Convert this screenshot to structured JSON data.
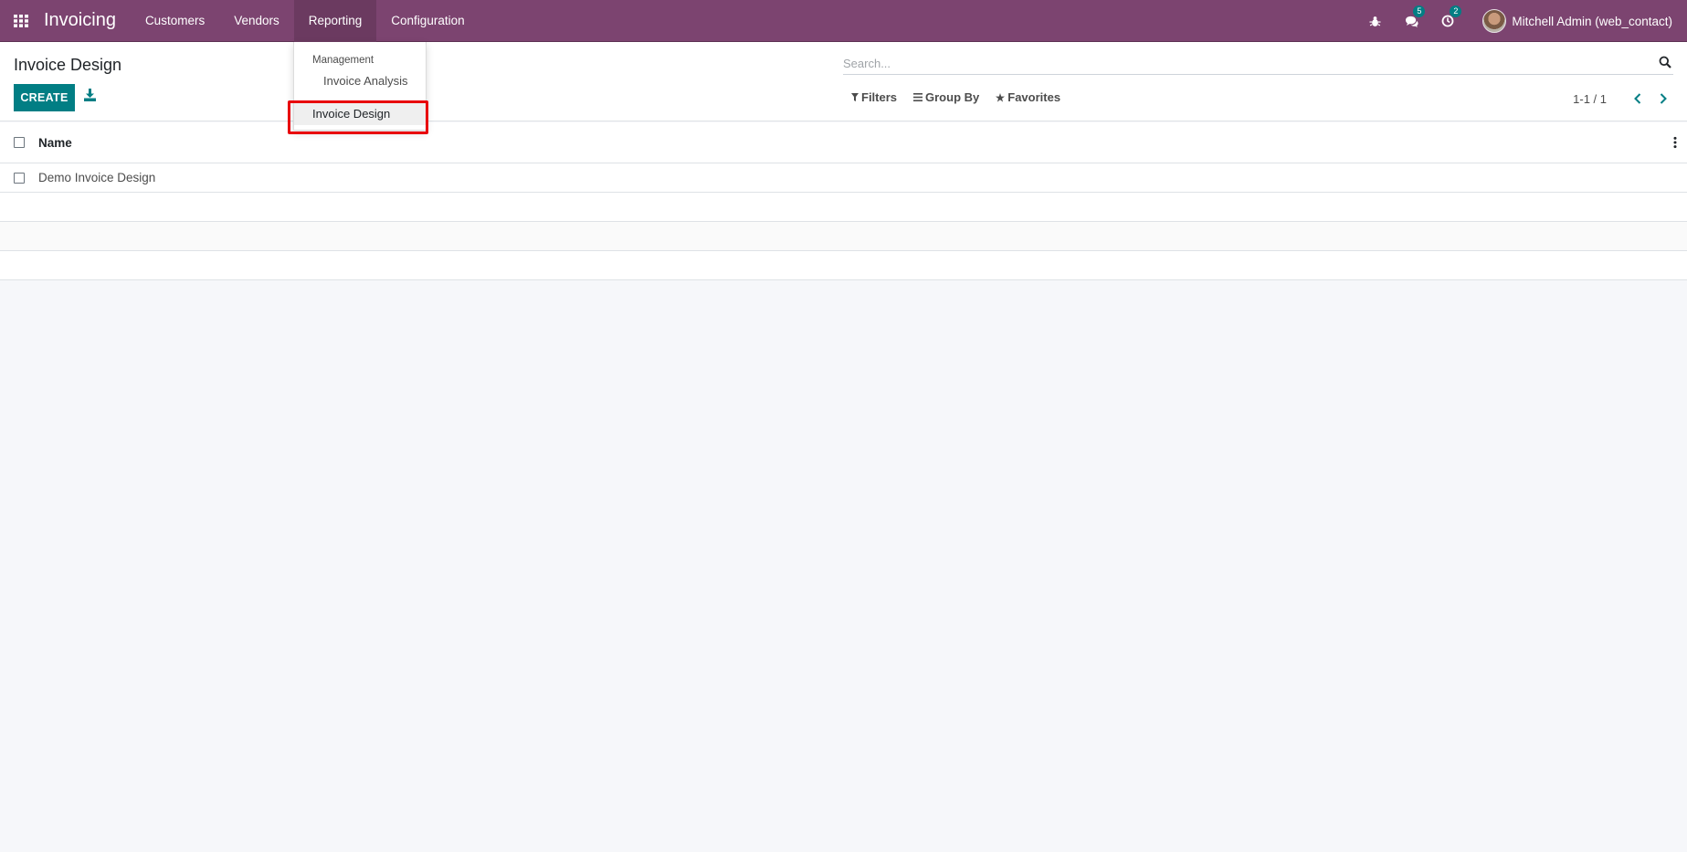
{
  "navbar": {
    "app_title": "Invoicing",
    "menu": [
      {
        "label": "Customers"
      },
      {
        "label": "Vendors"
      },
      {
        "label": "Reporting"
      },
      {
        "label": "Configuration"
      }
    ],
    "systray": {
      "bug_icon": "bug-icon",
      "messages_count": "5",
      "activities_count": "2",
      "user_name": "Mitchell Admin (web_contact)"
    },
    "colors": {
      "primary": "#7c4470",
      "accent": "#017e84"
    }
  },
  "control_panel": {
    "title": "Invoice Design",
    "create_label": "CREATE",
    "search_placeholder": "Search...",
    "filters_label": "Filters",
    "group_by_label": "Group By",
    "favorites_label": "Favorites",
    "pager_value": "1-1 / 1"
  },
  "list": {
    "header": {
      "name": "Name"
    },
    "rows": [
      {
        "name": "Demo Invoice Design"
      }
    ]
  },
  "reporting_dropdown": {
    "section_header": "Management",
    "items": [
      {
        "label": "Invoice Analysis"
      },
      {
        "label": "Invoice Design"
      }
    ]
  }
}
